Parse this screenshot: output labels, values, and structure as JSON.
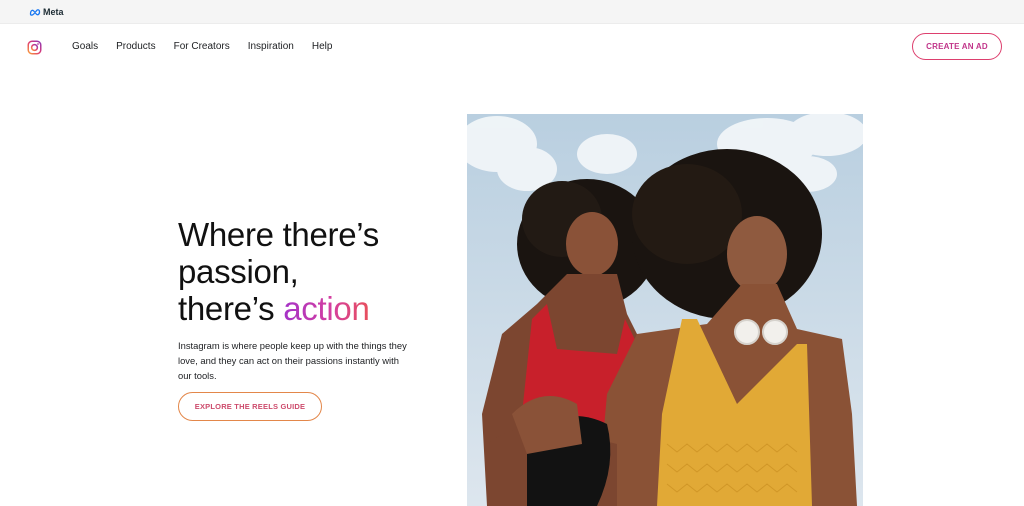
{
  "metabar": {
    "brand": "Meta"
  },
  "nav": {
    "links": [
      "Goals",
      "Products",
      "For Creators",
      "Inspiration",
      "Help"
    ],
    "cta": "CREATE AN AD"
  },
  "hero": {
    "headline_line1": "Where there’s",
    "headline_line2": "passion,",
    "headline_line3_prefix": "there’s ",
    "headline_accent": "action",
    "description": "Instagram is where people keep up with the things they love, and they can act on their passions instantly with our tools.",
    "button": "EXPLORE THE REELS GUIDE"
  },
  "colors": {
    "accent_gradient": [
      "#a433c8",
      "#d43ea0",
      "#e8505b"
    ],
    "button_border": "#dd3f6e",
    "sky": "#c7d7e4"
  },
  "icons": [
    "meta-logo-icon",
    "instagram-logo-icon"
  ]
}
